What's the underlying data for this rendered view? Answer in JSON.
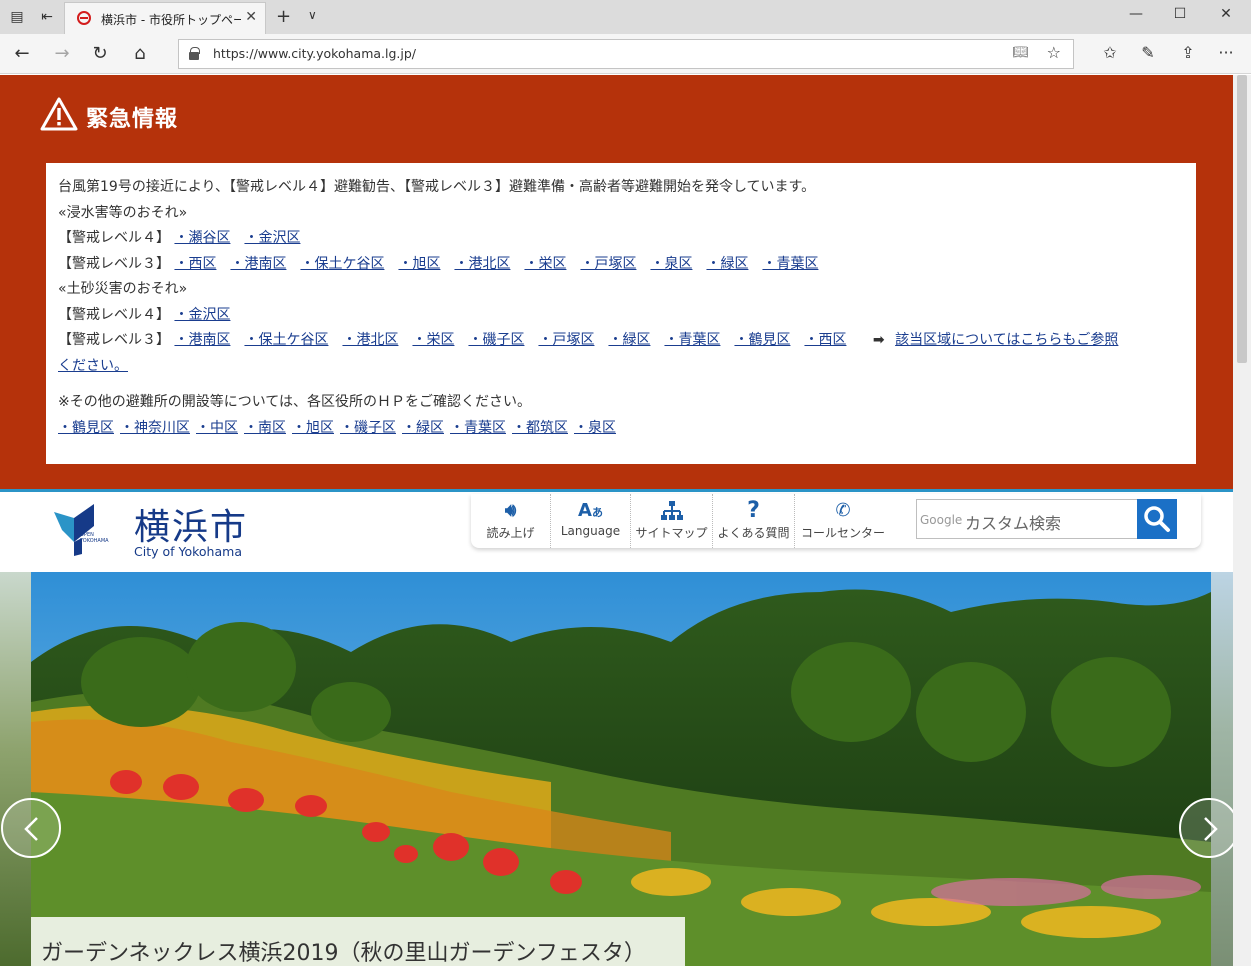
{
  "browser": {
    "tab_title": "横浜市 - 市役所トップペー",
    "url": "https://www.city.yokohama.lg.jp/"
  },
  "emergency": {
    "title": "緊急情報",
    "intro": "台風第19号の接近により、【警戒レベル４】避難勧告、【警戒レベル３】避難準備・高齢者等避難開始を発令しています。",
    "flood_heading": "«浸水害等のおそれ»",
    "level4_label": "【警戒レベル４】",
    "level3_label": "【警戒レベル３】",
    "flood_level4": [
      "・瀬谷区",
      "・金沢区"
    ],
    "flood_level3": [
      "・西区",
      "・港南区",
      "・保土ケ谷区",
      "・旭区",
      "・港北区",
      "・栄区",
      "・戸塚区",
      "・泉区",
      "・緑区",
      "・青葉区"
    ],
    "landslide_heading": "«土砂災害のおそれ»",
    "landslide_level4": [
      "・金沢区"
    ],
    "landslide_level3": [
      "・港南区",
      "・保土ケ谷区",
      "・港北区",
      "・栄区",
      "・磯子区",
      "・戸塚区",
      "・緑区",
      "・青葉区",
      "・鶴見区",
      "・西区"
    ],
    "more_link_1": "該当区域についてはこちらもご参照",
    "more_link_2": "ください。",
    "other_note": "※その他の避難所の開設等については、各区役所のＨＰをご確認ください。",
    "ward_links": [
      "・鶴見区",
      "・神奈川区",
      "・中区",
      "・南区",
      "・旭区",
      "・磯子区",
      "・緑区",
      "・青葉区",
      "・都筑区",
      "・泉区"
    ]
  },
  "header": {
    "logo_ja": "横浜市",
    "logo_en": "City of Yokohama",
    "logo_badge": "OPEN YOKOHAMA",
    "utility": [
      {
        "label": "読み上げ",
        "icon": "speaker-icon"
      },
      {
        "label": "Language",
        "icon": "language-icon"
      },
      {
        "label": "サイトマップ",
        "icon": "sitemap-icon"
      },
      {
        "label": "よくある質問",
        "icon": "question-icon"
      },
      {
        "label": "コールセンター",
        "icon": "phone-icon"
      }
    ],
    "search_brand": "Google",
    "search_placeholder": "カスタム検索"
  },
  "hero": {
    "caption": "ガーデンネックレス横浜2019（秋の里山ガーデンフェスタ）"
  },
  "colors": {
    "emergency_bg": "#b5320b",
    "brand_blue": "#163a88",
    "header_accent": "#2b94c7",
    "search_button": "#1b70c6"
  }
}
